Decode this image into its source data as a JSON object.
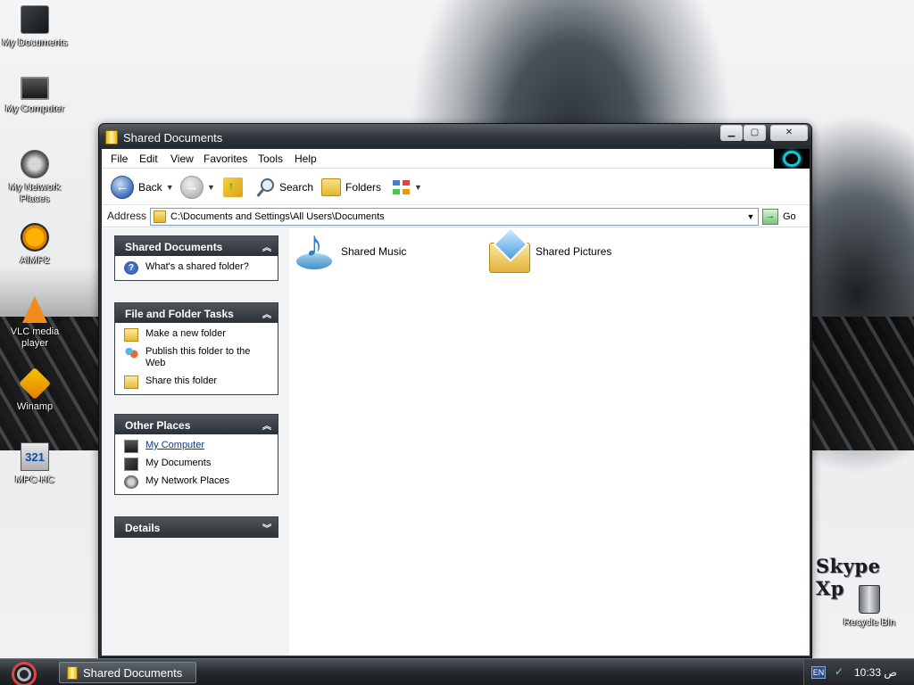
{
  "desktop": {
    "icons": [
      {
        "label": "My Documents",
        "icon": "my-documents-icon"
      },
      {
        "label": "My Computer",
        "icon": "my-computer-icon"
      },
      {
        "label": "My Network Places",
        "icon": "network-places-icon"
      },
      {
        "label": "AIMP2",
        "icon": "aimp-icon"
      },
      {
        "label": "VLC media player",
        "icon": "vlc-icon"
      },
      {
        "label": "Winamp",
        "icon": "winamp-icon"
      },
      {
        "label": "MPC-HC",
        "icon": "mpc-hc-icon"
      },
      {
        "label": "Recycle Bin",
        "icon": "recycle-bin-icon"
      }
    ],
    "wallpaper_text": "Skype Xp"
  },
  "window": {
    "title": "Shared Documents",
    "controls": {
      "minimize": "▁",
      "maximize": "▢",
      "close": "✕"
    },
    "menu": [
      "File",
      "Edit",
      "View",
      "Favorites",
      "Tools",
      "Help"
    ],
    "toolbar": {
      "back": "Back",
      "search": "Search",
      "folders": "Folders"
    },
    "address": {
      "label": "Address",
      "value": "C:\\Documents and Settings\\All Users\\Documents",
      "go": "Go"
    },
    "taskpane": {
      "panels": [
        {
          "title": "Shared Documents",
          "collapse": "︽",
          "tasks": [
            {
              "label": "What's a shared folder?",
              "icon": "help-icon"
            }
          ]
        },
        {
          "title": "File and Folder Tasks",
          "collapse": "︽",
          "tasks": [
            {
              "label": "Make a new folder",
              "icon": "new-folder-icon"
            },
            {
              "label": "Publish this folder to the Web",
              "icon": "publish-web-icon"
            },
            {
              "label": "Share this folder",
              "icon": "share-folder-icon"
            }
          ]
        },
        {
          "title": "Other Places",
          "collapse": "︽",
          "tasks": [
            {
              "label": "My Computer",
              "icon": "my-computer-icon",
              "hovered": true
            },
            {
              "label": "My Documents",
              "icon": "my-documents-icon"
            },
            {
              "label": "My Network Places",
              "icon": "network-places-icon"
            }
          ]
        },
        {
          "title": "Details",
          "collapse": "︾"
        }
      ]
    },
    "files": [
      {
        "label": "Shared Music",
        "icon": "shared-music-icon"
      },
      {
        "label": "Shared Pictures",
        "icon": "shared-pictures-icon"
      }
    ]
  },
  "taskbar": {
    "task_label": "Shared Documents",
    "language": "EN",
    "clock": "10:33 ص"
  }
}
